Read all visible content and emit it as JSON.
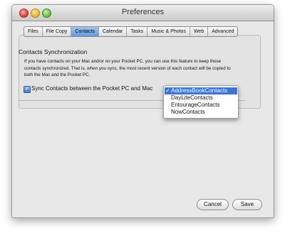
{
  "window": {
    "title": "Preferences"
  },
  "tabs": [
    "Files",
    "File Copy",
    "Contacts",
    "Calendar",
    "Tasks",
    "Music & Photos",
    "Web",
    "Advanced"
  ],
  "active_tab": "Contacts",
  "contacts": {
    "section_title": "Contacts Synchronization",
    "description": "If you have contacts on your Mac and/or on your Pocket PC, you can use this feature to keep those contacts synchronized. That is, when you sync, the most recent version of each contact will be copied to both the Mac and the Pocket PC.",
    "sync_label": "Sync Contacts between the Pocket PC and Mac",
    "sync_checked": true,
    "dropdown": {
      "options": [
        "AddressBookContacts",
        "DayLiteContacts",
        "EntourageContacts",
        "NowContacts"
      ],
      "selected": "AddressBookContacts",
      "check_glyph": "✓"
    }
  },
  "buttons": {
    "cancel": "Cancel",
    "save": "Save"
  }
}
